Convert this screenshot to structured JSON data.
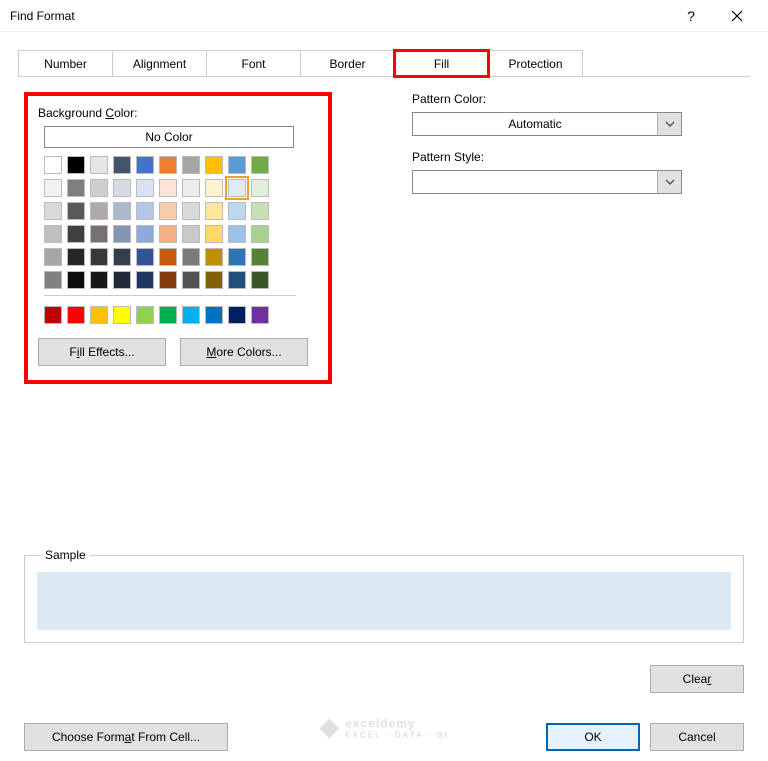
{
  "title": "Find Format",
  "tabs": [
    "Number",
    "Alignment",
    "Font",
    "Border",
    "Fill",
    "Protection"
  ],
  "activeTab": "Fill",
  "left": {
    "bgLabelPre": "Background ",
    "bgLabelU": "C",
    "bgLabelPost": "olor:",
    "noColor": "No Color",
    "fillEffects": "Fill Effects...",
    "moreColors": "More Colors...",
    "moreColorsU": "M"
  },
  "right": {
    "patternColorLabel": "Pattern Color:",
    "patternColorValue": "Automatic",
    "patternStyleLabel": "Pattern Style:",
    "patternStyleValue": ""
  },
  "sampleLabel": "Sample",
  "sampleColor": "#dbe9f4",
  "clearLabel": "Clear",
  "chooseFormat": "Choose Format From Cell...",
  "chooseFormatU": "a",
  "ok": "OK",
  "cancel": "Cancel",
  "palette": {
    "row1": [
      "#ffffff",
      "#000000",
      "#e7e6e6",
      "#44546a",
      "#4472c4",
      "#ed7d31",
      "#a5a5a5",
      "#ffc000",
      "#5b9bd5",
      "#70ad47"
    ],
    "row2": [
      "#f2f2f2",
      "#7f7f7f",
      "#d0cece",
      "#d6dce4",
      "#d9e1f2",
      "#fce4d6",
      "#ededed",
      "#fff2cc",
      "#ddebf7",
      "#e2efda"
    ],
    "row3": [
      "#d9d9d9",
      "#595959",
      "#aeaaaa",
      "#acb9ca",
      "#b4c6e7",
      "#f8cbad",
      "#dbdbdb",
      "#ffe699",
      "#bdd7ee",
      "#c6e0b4"
    ],
    "row4": [
      "#bfbfbf",
      "#404040",
      "#757171",
      "#8497b0",
      "#8ea9db",
      "#f4b084",
      "#c9c9c9",
      "#ffd966",
      "#9bc2e6",
      "#a9d08e"
    ],
    "row5": [
      "#a6a6a6",
      "#262626",
      "#3a3838",
      "#333f4f",
      "#305496",
      "#c65911",
      "#7b7b7b",
      "#bf8f00",
      "#2f75b5",
      "#548235"
    ],
    "row6": [
      "#808080",
      "#0d0d0d",
      "#161616",
      "#222b35",
      "#203764",
      "#833c0c",
      "#525252",
      "#806000",
      "#1f4e78",
      "#375623"
    ],
    "std": [
      "#c00000",
      "#ff0000",
      "#ffc000",
      "#ffff00",
      "#92d050",
      "#00b050",
      "#00b0f0",
      "#0070c0",
      "#002060",
      "#7030a0"
    ],
    "selected": "#ddebf7"
  },
  "watermark": {
    "brand": "exceldemy",
    "sub": "EXCEL · DATA · BI"
  }
}
